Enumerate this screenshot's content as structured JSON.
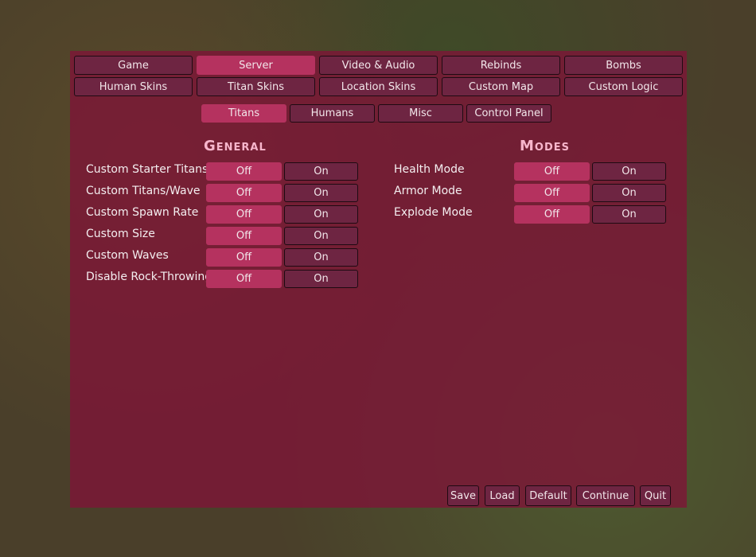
{
  "tabs_row1": [
    {
      "label": "Game"
    },
    {
      "label": "Server",
      "active": true
    },
    {
      "label": "Video & Audio"
    },
    {
      "label": "Rebinds"
    },
    {
      "label": "Bombs"
    }
  ],
  "tabs_row2": [
    {
      "label": "Human Skins"
    },
    {
      "label": "Titan Skins"
    },
    {
      "label": "Location Skins"
    },
    {
      "label": "Custom Map"
    },
    {
      "label": "Custom Logic"
    }
  ],
  "subtabs": [
    {
      "label": "Titans",
      "active": true
    },
    {
      "label": "Humans"
    },
    {
      "label": "Misc"
    },
    {
      "label": "Control Panel"
    }
  ],
  "general": {
    "title": "General",
    "rows": [
      {
        "label": "Custom Starter Titans",
        "value": "Off"
      },
      {
        "label": "Custom Titans/Wave",
        "value": "Off"
      },
      {
        "label": "Custom Spawn Rate",
        "value": "Off"
      },
      {
        "label": "Custom Size",
        "value": "Off"
      },
      {
        "label": "Custom Waves",
        "value": "Off"
      },
      {
        "label": "Disable Rock-Throwing",
        "value": "Off"
      }
    ]
  },
  "modes": {
    "title": "Modes",
    "rows": [
      {
        "label": "Health Mode",
        "value": "Off"
      },
      {
        "label": "Armor Mode",
        "value": "Off"
      },
      {
        "label": "Explode Mode",
        "value": "Off"
      }
    ]
  },
  "toggle": {
    "off": "Off",
    "on": "On"
  },
  "footer": [
    {
      "label": "Save"
    },
    {
      "label": "Load"
    },
    {
      "label": "Default"
    },
    {
      "label": "Continue"
    },
    {
      "label": "Quit"
    }
  ],
  "colors": {
    "panel": "#7d1637",
    "active": "#b5325f",
    "inactive": "#6e2542",
    "heading": "#f7b6cc"
  }
}
